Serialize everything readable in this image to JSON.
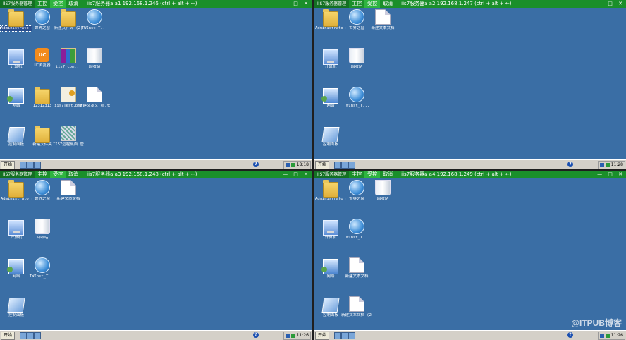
{
  "panes": [
    {
      "app": "IIS7服务器管理",
      "tabs": [
        "主控",
        "受控",
        "取消"
      ],
      "active_tab": 1,
      "info": "iis7服务器a   a1   192.168.1.246     (ctrl + alt + ←)",
      "controls": "— □ ✕",
      "icons": [
        {
          "label": "Administrato r",
          "icon": "folder-icon",
          "cls": "ic-folder",
          "selected": true
        },
        {
          "label": "世界之窗",
          "icon": "globe-icon",
          "cls": "ic-globe"
        },
        {
          "label": "新建文件夹 (2)",
          "icon": "folder-icon",
          "cls": "ic-folder"
        },
        {
          "label": "TWInst_T...",
          "icon": "installer-icon",
          "cls": "ic-globe"
        },
        {
          "label": "计算机",
          "icon": "computer-icon",
          "cls": "ic-pc"
        },
        {
          "label": "UC浏览器",
          "icon": "uc-browser-icon",
          "cls": "ic-uc",
          "glyph": "UC"
        },
        {
          "label": "iis7.com...",
          "icon": "winrar-icon",
          "cls": "ic-rar"
        },
        {
          "label": "回收站",
          "icon": "recycle-bin-icon",
          "cls": "ic-bin"
        },
        {
          "label": "网络",
          "icon": "network-icon",
          "cls": "ic-net"
        },
        {
          "label": "12312313",
          "icon": "folder-icon",
          "cls": "ic-folder"
        },
        {
          "label": "iis7Test.pfx",
          "icon": "certificate-icon",
          "cls": "ic-cert"
        },
        {
          "label": "新建文本文 档.txt",
          "icon": "text-document-icon",
          "cls": "ic-doc"
        },
        {
          "label": "控制面板",
          "icon": "control-panel-icon",
          "cls": "ic-panel"
        },
        {
          "label": "新建文件夹",
          "icon": "folder-icon",
          "cls": "ic-folder"
        },
        {
          "label": "IIS7远程桌面 管理 (1).exe",
          "icon": "remote-desktop-icon",
          "cls": "ic-rdp"
        }
      ],
      "taskbar": {
        "start": "开始",
        "clock": "18:18"
      }
    },
    {
      "app": "IIS7服务器管理",
      "tabs": [
        "主控",
        "受控",
        "取消"
      ],
      "active_tab": 1,
      "info": "iis7服务器a   a2   192.168.1.247     (ctrl + alt + ←)",
      "controls": "— □ ✕",
      "icons": [
        {
          "label": "Administrato r",
          "icon": "folder-icon",
          "cls": "ic-folder"
        },
        {
          "label": "世界之窗",
          "icon": "globe-icon",
          "cls": "ic-globe"
        },
        {
          "label": "新建文本文档",
          "icon": "text-document-icon",
          "cls": "ic-doc"
        },
        {
          "label": "计算机",
          "icon": "computer-icon",
          "cls": "ic-pc"
        },
        {
          "label": "回收站",
          "icon": "recycle-bin-icon",
          "cls": "ic-bin"
        },
        {
          "label": "网络",
          "icon": "network-icon",
          "cls": "ic-net"
        },
        {
          "label": "TWInst_T...",
          "icon": "installer-icon",
          "cls": "ic-globe"
        },
        {
          "label": "控制面板",
          "icon": "control-panel-icon",
          "cls": "ic-panel"
        }
      ],
      "taskbar": {
        "start": "开始",
        "clock": "11:28"
      }
    },
    {
      "app": "IIS7服务器管理",
      "tabs": [
        "主控",
        "受控",
        "取消"
      ],
      "active_tab": 1,
      "info": "iis7服务器a   a3   192.168.1.248     (ctrl + alt + ←)",
      "controls": "— □ ✕",
      "icons": [
        {
          "label": "Administrato r",
          "icon": "folder-icon",
          "cls": "ic-folder"
        },
        {
          "label": "世界之窗",
          "icon": "globe-icon",
          "cls": "ic-globe"
        },
        {
          "label": "新建文本文档",
          "icon": "text-document-icon",
          "cls": "ic-doc"
        },
        {
          "label": "计算机",
          "icon": "computer-icon",
          "cls": "ic-pc"
        },
        {
          "label": "回收站",
          "icon": "recycle-bin-icon",
          "cls": "ic-bin"
        },
        {
          "label": "网络",
          "icon": "network-icon",
          "cls": "ic-net"
        },
        {
          "label": "TWInst_T...",
          "icon": "installer-icon",
          "cls": "ic-globe"
        },
        {
          "label": "控制面板",
          "icon": "control-panel-icon",
          "cls": "ic-panel"
        }
      ],
      "taskbar": {
        "start": "开始",
        "clock": "11:26"
      }
    },
    {
      "app": "IIS7服务器管理",
      "tabs": [
        "主控",
        "受控",
        "取消"
      ],
      "active_tab": 1,
      "info": "iis7服务器a   a4   192.168.1.249     (ctrl + alt + ←)",
      "controls": "— □ ✕",
      "icons": [
        {
          "label": "Administrato r",
          "icon": "folder-icon",
          "cls": "ic-folder"
        },
        {
          "label": "世界之窗",
          "icon": "globe-icon",
          "cls": "ic-globe"
        },
        {
          "label": "回收站",
          "icon": "recycle-bin-icon",
          "cls": "ic-bin"
        },
        {
          "label": "计算机",
          "icon": "computer-icon",
          "cls": "ic-pc"
        },
        {
          "label": "TWInst_T...",
          "icon": "installer-icon",
          "cls": "ic-globe"
        },
        {
          "label": "网络",
          "icon": "network-icon",
          "cls": "ic-net"
        },
        {
          "label": "新建文本文档",
          "icon": "text-document-icon",
          "cls": "ic-doc"
        },
        {
          "label": "控制面板",
          "icon": "control-panel-icon",
          "cls": "ic-panel"
        },
        {
          "label": "新建文本文档 (2)",
          "icon": "text-document-icon",
          "cls": "ic-doc"
        }
      ],
      "taskbar": {
        "start": "开始",
        "clock": "11:26"
      }
    }
  ],
  "watermark": "@ITPUB博客"
}
